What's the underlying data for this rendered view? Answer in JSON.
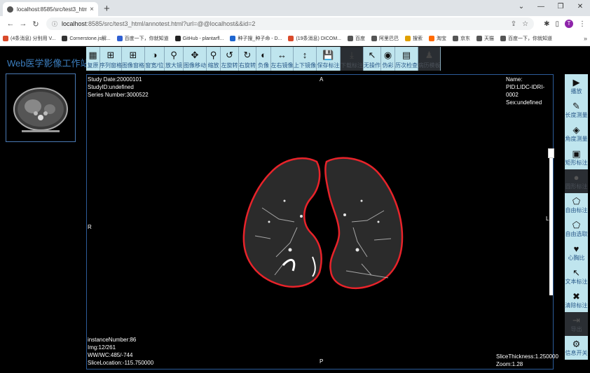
{
  "browser": {
    "tab_title": "localhost:8585/src/test3_html/",
    "tab_close": "×",
    "new_tab": "+",
    "url_host": "localhost",
    "url_rest": ":8585/src/test3_html/annotest.html?url=@@localhost&&id=2",
    "avatar_letter": "T",
    "bookmarks": [
      {
        "label": "(4条消息) 分别用 V...",
        "color": "#d94a2b"
      },
      {
        "label": "Cornerstone.js解...",
        "color": "#333333"
      },
      {
        "label": "百度一下，你就知道",
        "color": "#2f5fd1"
      },
      {
        "label": "GitHub - plantarfl...",
        "color": "#222222"
      },
      {
        "label": "种子搜_种子命 - D...",
        "color": "#1e66d0"
      },
      {
        "label": "(19条消息) DICOM...",
        "color": "#d94a2b"
      },
      {
        "label": "百度",
        "color": "#555555"
      },
      {
        "label": "阿里巴巴",
        "color": "#555555"
      },
      {
        "label": "搜索",
        "color": "#e0a000"
      },
      {
        "label": "淘宝",
        "color": "#ff6a00"
      },
      {
        "label": "京东",
        "color": "#555555"
      },
      {
        "label": "天猫",
        "color": "#555555"
      },
      {
        "label": "百度一下，你就知道",
        "color": "#555555"
      }
    ],
    "bookmarks_more": "»"
  },
  "app": {
    "title": "Web医学影像工作站",
    "toolbar": [
      {
        "label": "复原",
        "icon": "▦",
        "disabled": false,
        "w": 20
      },
      {
        "label": "序列窗格",
        "icon": "⊞",
        "disabled": false,
        "w": 31
      },
      {
        "label": "图像窗格",
        "icon": "⊞",
        "disabled": false,
        "w": 33
      },
      {
        "label": "窗宽/位",
        "icon": "◑",
        "disabled": false,
        "w": 28
      },
      {
        "label": "放大镜",
        "icon": "⚲",
        "disabled": false,
        "w": 27
      },
      {
        "label": "图像移动",
        "icon": "✥",
        "disabled": false,
        "w": 33
      },
      {
        "label": "缩放",
        "icon": "⚲",
        "disabled": false,
        "w": 20
      },
      {
        "label": "左旋转",
        "icon": "↺",
        "disabled": false,
        "w": 26
      },
      {
        "label": "右旋转",
        "icon": "↻",
        "disabled": false,
        "w": 25
      },
      {
        "label": "负像",
        "icon": "◐",
        "disabled": false,
        "w": 21
      },
      {
        "label": "左右镜像",
        "icon": "↔",
        "disabled": false,
        "w": 32
      },
      {
        "label": "上下镜像",
        "icon": "↕",
        "disabled": false,
        "w": 33
      },
      {
        "label": "保存标注",
        "icon": "💾",
        "disabled": false,
        "w": 34
      },
      {
        "label": "下载标注",
        "icon": "⤓",
        "disabled": true,
        "w": 33
      },
      {
        "label": "无操作",
        "icon": "↖",
        "disabled": false,
        "w": 25
      },
      {
        "label": "伪彩",
        "icon": "◉",
        "disabled": false,
        "w": 20
      },
      {
        "label": "历次检查",
        "icon": "▤",
        "disabled": false,
        "w": 33
      },
      {
        "label": "病历模板",
        "icon": "♟",
        "disabled": true,
        "w": 32
      }
    ],
    "overlay": {
      "study_date": "Study Date:20000101",
      "study_id": "StudyID:undefined",
      "series_number": "Series Number:3000522",
      "name": "Name:",
      "pid": "PID:LIDC-IDRI-0002",
      "sex": "Sex:undefined",
      "instance_number": "instanceNumber:86",
      "img": "Img:12/261",
      "ww_wc": "WW/WC:485/-744",
      "slice_location": "SliceLocation:-115.750000",
      "slice_thickness": "SliceThickness:1.250000",
      "zoom": "Zoom:1.28",
      "orient_top": "A",
      "orient_bottom": "P",
      "orient_left": "R",
      "orient_right": "L"
    },
    "right_tools": [
      {
        "label": "播放",
        "icon": "▶",
        "disabled": false
      },
      {
        "label": "长度测量",
        "icon": "✎",
        "disabled": false
      },
      {
        "label": "角度测量",
        "icon": "◈",
        "disabled": false
      },
      {
        "label": "矩形标注",
        "icon": "▣",
        "disabled": false
      },
      {
        "label": "圆形标注",
        "icon": "●",
        "disabled": true
      },
      {
        "label": "自由标注",
        "icon": "⬠",
        "disabled": false
      },
      {
        "label": "自由选取",
        "icon": "⬠",
        "disabled": false
      },
      {
        "label": "心胸比",
        "icon": "♥",
        "disabled": false
      },
      {
        "label": "文本标注",
        "icon": "↖",
        "disabled": false
      },
      {
        "label": "清除标注",
        "icon": "✖",
        "disabled": false
      },
      {
        "label": "导出",
        "icon": "⇥",
        "disabled": true
      },
      {
        "label": "信息开关",
        "icon": "⚙",
        "disabled": false
      }
    ]
  }
}
